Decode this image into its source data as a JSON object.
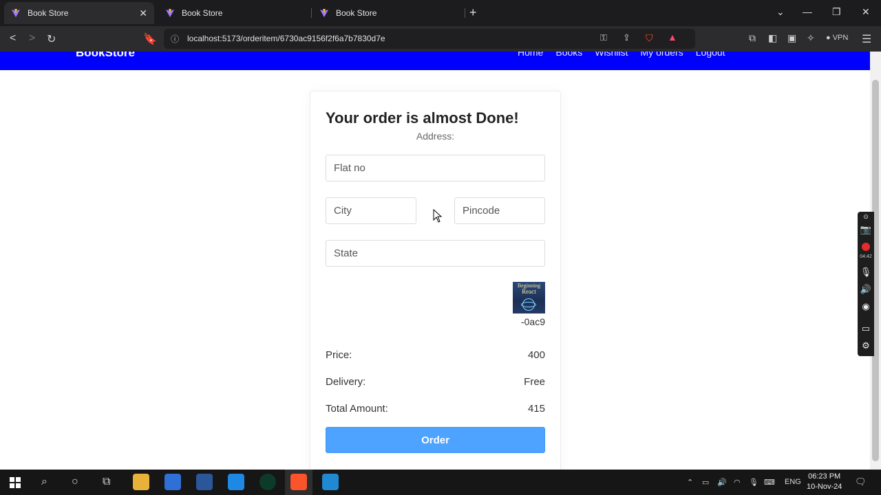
{
  "browser": {
    "tabs": [
      {
        "title": "Book Store",
        "active": true
      },
      {
        "title": "Book Store",
        "active": false
      },
      {
        "title": "Book Store",
        "active": false
      }
    ],
    "url": "localhost:5173/orderitem/6730ac9156f2f6a7b7830d7e",
    "vpn_label": "VPN"
  },
  "navbar": {
    "brand": "BookStore",
    "links": [
      "Home",
      "Books",
      "Wishlist",
      "My orders",
      "Logout"
    ],
    "background_color": "#0000ff"
  },
  "order_form": {
    "title": "Your order is almost Done!",
    "address_label": "Address:",
    "flat_placeholder": "Flat no",
    "city_placeholder": "City",
    "pincode_placeholder": "Pincode",
    "state_placeholder": "State",
    "book_cover_text": [
      "Beginning",
      "React"
    ],
    "book_id": "-0ac9",
    "price_label": "Price:",
    "price_value": "400",
    "delivery_label": "Delivery:",
    "delivery_value": "Free",
    "total_label": "Total Amount:",
    "total_value": "415",
    "order_button": "Order",
    "accent_color": "#4da3ff"
  },
  "recorder": {
    "elapsed": "04:42"
  },
  "taskbar": {
    "language": "ENG",
    "time": "06:23 PM",
    "date": "10-Nov-24"
  }
}
